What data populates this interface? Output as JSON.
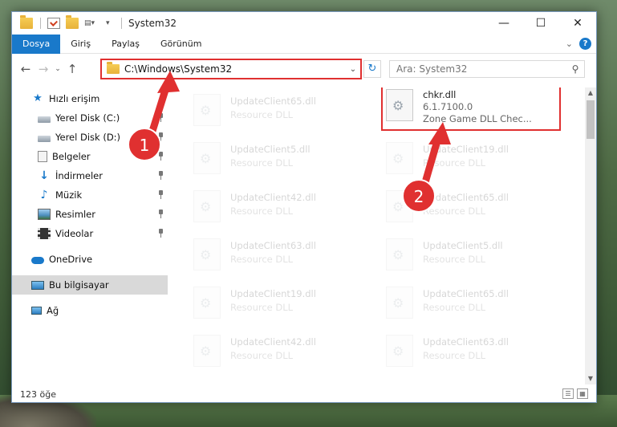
{
  "window": {
    "title": "System32",
    "controls": {
      "minimize": "—",
      "maximize": "☐",
      "close": "✕"
    }
  },
  "ribbon": {
    "tabs": [
      {
        "label": "Dosya",
        "active": true
      },
      {
        "label": "Giriş",
        "active": false
      },
      {
        "label": "Paylaş",
        "active": false
      },
      {
        "label": "Görünüm",
        "active": false
      }
    ],
    "help": "?"
  },
  "nav": {
    "address": "C:\\Windows\\System32",
    "search_placeholder": "Ara: System32"
  },
  "sidebar": {
    "items": [
      {
        "label": "Hızlı erişim",
        "icon": "star-icon",
        "pinned": false
      },
      {
        "label": "Yerel Disk (C:)",
        "icon": "disk-icon",
        "pinned": true
      },
      {
        "label": "Yerel Disk (D:)",
        "icon": "disk-icon",
        "pinned": true
      },
      {
        "label": "Belgeler",
        "icon": "document-icon",
        "pinned": true
      },
      {
        "label": "İndirmeler",
        "icon": "download-icon",
        "pinned": true
      },
      {
        "label": "Müzik",
        "icon": "music-icon",
        "pinned": true
      },
      {
        "label": "Resimler",
        "icon": "pictures-icon",
        "pinned": true
      },
      {
        "label": "Videolar",
        "icon": "video-icon",
        "pinned": true
      },
      {
        "label": "OneDrive",
        "icon": "cloud-icon",
        "pinned": false
      },
      {
        "label": "Bu bilgisayar",
        "icon": "computer-icon",
        "pinned": false,
        "selected": true
      },
      {
        "label": "Ağ",
        "icon": "network-icon",
        "pinned": false
      }
    ]
  },
  "files": [
    {
      "name": "UpdateClient65.dll",
      "sub": "Resource DLL"
    },
    {
      "name": "chkr.dll",
      "version": "6.1.7100.0",
      "sub": "Zone Game DLL   Chec...",
      "highlight": true
    },
    {
      "name": "UpdateClient5.dll",
      "sub": "Resource DLL"
    },
    {
      "name": "UpdateClient19.dll",
      "sub": "Resource DLL"
    },
    {
      "name": "UpdateClient42.dll",
      "sub": "Resource DLL"
    },
    {
      "name": "UpdateClient65.dll",
      "sub": "Resource DLL"
    },
    {
      "name": "UpdateClient63.dll",
      "sub": "Resource DLL"
    },
    {
      "name": "UpdateClient5.dll",
      "sub": "Resource DLL"
    },
    {
      "name": "UpdateClient19.dll",
      "sub": "Resource DLL"
    },
    {
      "name": "UpdateClient65.dll",
      "sub": "Resource DLL"
    },
    {
      "name": "UpdateClient42.dll",
      "sub": "Resource DLL"
    },
    {
      "name": "UpdateClient63.dll",
      "sub": "Resource DLL"
    }
  ],
  "status": {
    "count": "123 öğe"
  },
  "annotations": {
    "marker1": "1",
    "marker2": "2",
    "color": "#e03030"
  }
}
